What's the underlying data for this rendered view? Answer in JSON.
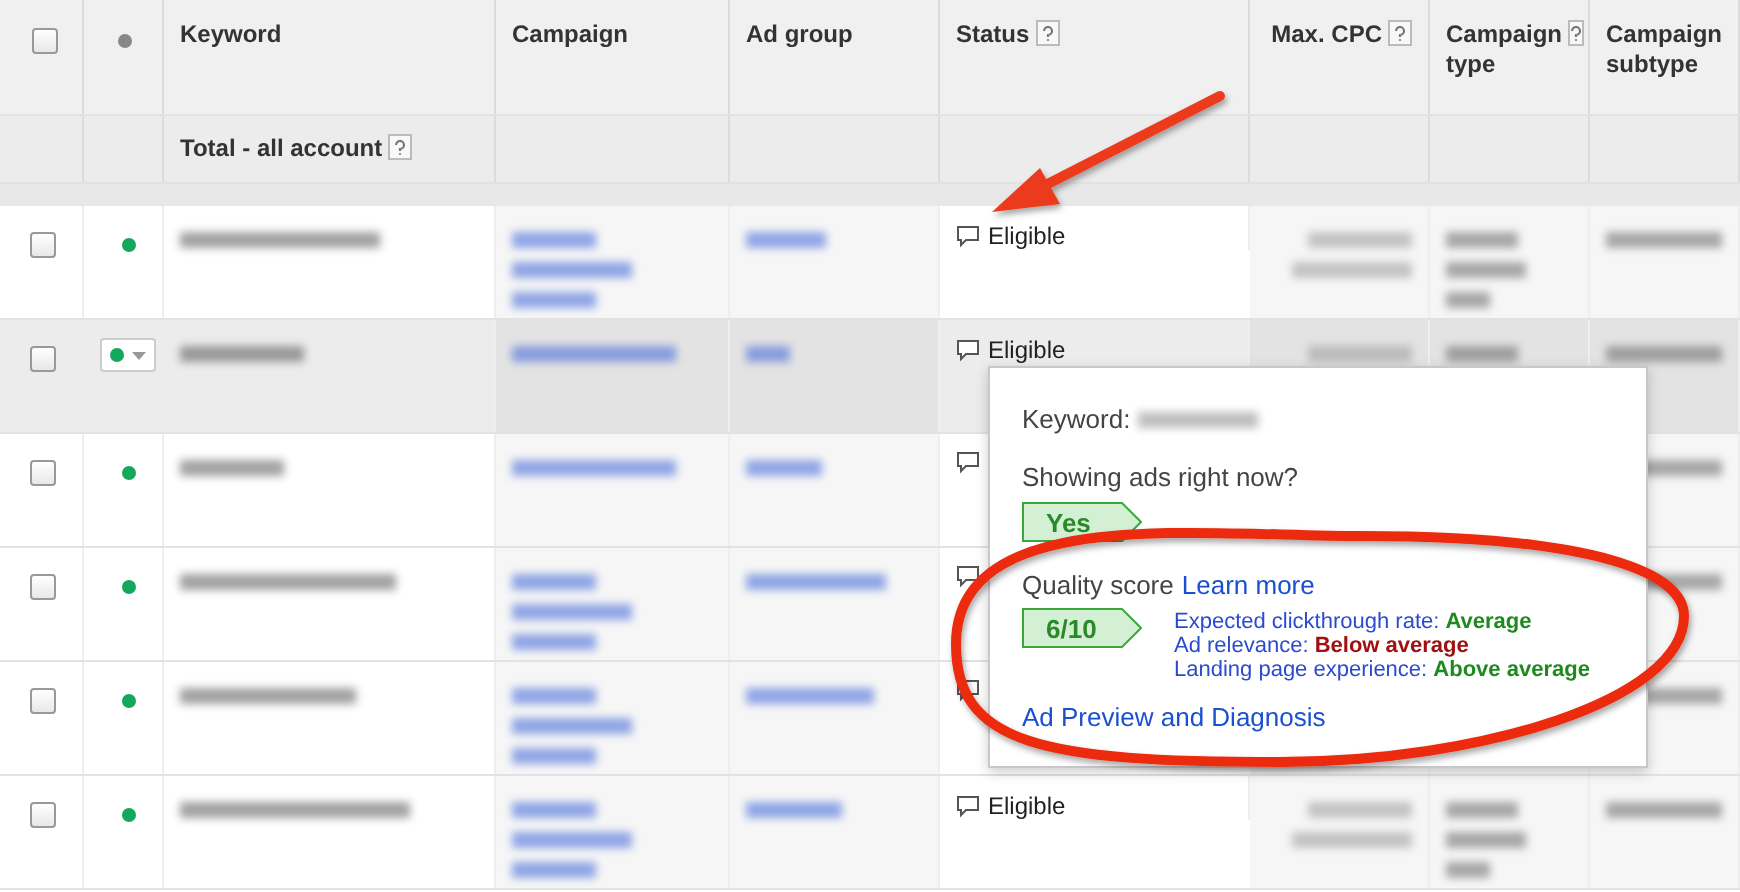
{
  "table": {
    "header_checkbox": {
      "checked": false
    },
    "columns": [
      {
        "label": "Keyword",
        "help": false
      },
      {
        "label": "Campaign",
        "help": false
      },
      {
        "label": "Ad group",
        "help": false
      },
      {
        "label": "Status",
        "help": true
      },
      {
        "label": "Max. CPC",
        "help": true
      },
      {
        "label": "Campaign type",
        "help": true
      },
      {
        "label": "Campaign subtype",
        "help": false
      }
    ],
    "total_row": {
      "label": "Total - all account",
      "help": true
    },
    "rows": [
      {
        "checked": false,
        "highlighted": false,
        "color": "#14a85c",
        "status": "Eligible"
      },
      {
        "checked": false,
        "highlighted": true,
        "color": "#14a85c",
        "status": "Eligible"
      },
      {
        "checked": false,
        "highlighted": false,
        "color": "#14a85c"
      },
      {
        "checked": false,
        "highlighted": false,
        "color": "#14a85c"
      },
      {
        "checked": false,
        "highlighted": false,
        "color": "#14a85c"
      },
      {
        "checked": false,
        "highlighted": false,
        "color": "#14a85c",
        "status": "Eligible"
      }
    ]
  },
  "popup": {
    "keyword_label": "Keyword:",
    "question": "Showing ads right now?",
    "answer": "Yes",
    "quality_label": "Quality score",
    "learn_more": "Learn more",
    "score": "6/10",
    "factors": [
      {
        "label": "Expected clickthrough rate:",
        "value": "Average",
        "color": "#1e8a1e"
      },
      {
        "label": "Ad relevance:",
        "value": "Below average",
        "color": "#a01010"
      },
      {
        "label": "Landing page experience:",
        "value": "Above average",
        "color": "#1e8a1e"
      }
    ],
    "link": "Ad Preview and Diagnosis"
  }
}
